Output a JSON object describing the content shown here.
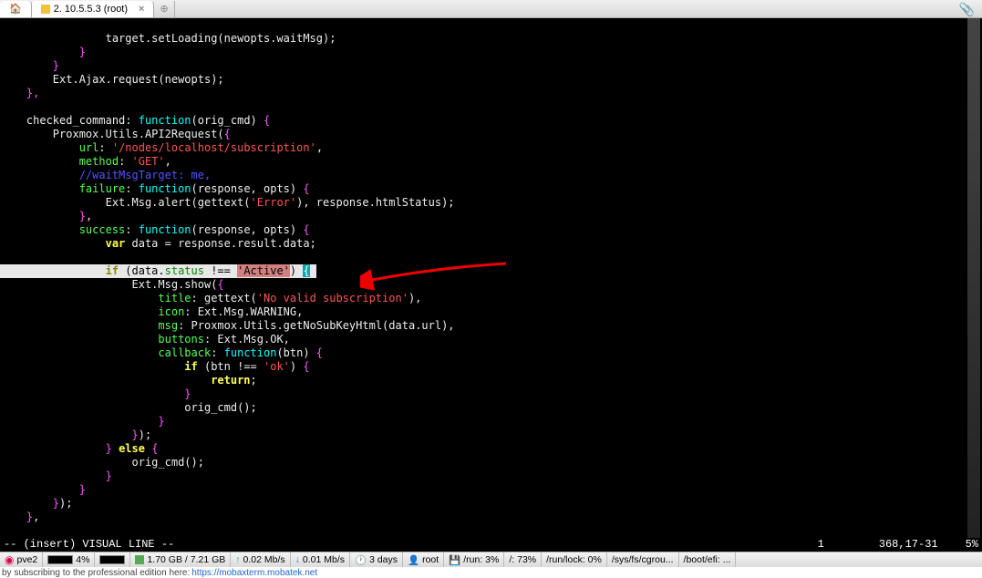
{
  "tabs": {
    "active_title": "2. 10.5.5.3 (root)"
  },
  "code": {
    "l1": "                target.setLoading(newopts.waitMsg);",
    "l2": "            }",
    "l3": "        }",
    "l4": "        Ext.Ajax.request(newopts);",
    "l5": "    },",
    "l6": "",
    "l7": "    checked_command: ",
    "l7b": "function",
    "l7c": "(orig_cmd) ",
    "l7d": "{",
    "l8": "        Proxmox.Utils.API2Request(",
    "l8b": "{",
    "l9": "            ",
    "l9a": "url",
    "l9b": ": ",
    "l9c": "'/nodes/localhost/subscription'",
    "l9d": ",",
    "l10a": "            ",
    "l10b": "method",
    "l10c": ": ",
    "l10d": "'GET'",
    "l10e": ",",
    "l11": "            //waitMsgTarget: me,",
    "l12a": "            ",
    "l12b": "failure",
    "l12c": ": ",
    "l12d": "function",
    "l12e": "(response, opts) ",
    "l12f": "{",
    "l13": "                Ext.Msg.alert(gettext(",
    "l13b": "'Error'",
    "l13c": "), response.htmlStatus);",
    "l14": "            ",
    "l14b": "}",
    "l14c": ",",
    "l15a": "            ",
    "l15b": "success",
    "l15c": ": ",
    "l15d": "function",
    "l15e": "(response, opts) ",
    "l15f": "{",
    "l16a": "                ",
    "l16b": "var",
    "l16c": " data = response.result.data;",
    "hl_pre": "                ",
    "hl_if": "if",
    "hl_open": " (data.",
    "hl_status": "status",
    "hl_neq": " !== ",
    "hl_active": "'Active'",
    "hl_close": ") ",
    "hl_brace": "{",
    "l18": "                    Ext.Msg.show(",
    "l18b": "{",
    "l19a": "                        ",
    "l19b": "title",
    "l19c": ": gettext(",
    "l19d": "'No valid subscription'",
    "l19e": "),",
    "l20a": "                        ",
    "l20b": "icon",
    "l20c": ": Ext.Msg.WARNING,",
    "l21a": "                        ",
    "l21b": "msg",
    "l21c": ": Proxmox.Utils.getNoSubKeyHtml(data.url),",
    "l22a": "                        ",
    "l22b": "buttons",
    "l22c": ": Ext.Msg.OK,",
    "l23a": "                        ",
    "l23b": "callback",
    "l23c": ": ",
    "l23d": "function",
    "l23e": "(btn) ",
    "l23f": "{",
    "l24a": "                            ",
    "l24b": "if",
    "l24c": " (btn !== ",
    "l24d": "'ok'",
    "l24e": ") ",
    "l24f": "{",
    "l25a": "                                ",
    "l25b": "return",
    "l25c": ";",
    "l26": "                            ",
    "l26b": "}",
    "l27": "                            orig_cmd();",
    "l28": "                        ",
    "l28b": "}",
    "l29": "                    ",
    "l29b": "}",
    "l29c": ");",
    "l30": "                ",
    "l30b": "}",
    "l30c": " ",
    "l30d": "else",
    "l30e": " ",
    "l30f": "{",
    "l31": "                    orig_cmd();",
    "l32": "                ",
    "l32b": "}",
    "l33": "            ",
    "l33b": "}",
    "l34": "        ",
    "l34b": "}",
    "l34c": ");",
    "l35": "    ",
    "l35b": "}",
    "l35c": ","
  },
  "status": {
    "mode": "-- (insert) VISUAL LINE --",
    "count": "1",
    "pos": "368,17-31",
    "pct": "5%"
  },
  "toolbar": {
    "host": "pve2",
    "cpu": "4%",
    "mem": "1.70 GB / 7.21 GB",
    "up": "0.02 Mb/s",
    "down": "0.01 Mb/s",
    "uptime": "3 days",
    "user": "root",
    "disk1": "/run: 3%",
    "disk2": "/: 73%",
    "disk3": "/run/lock: 0%",
    "disk4": "/sys/fs/cgrou...",
    "disk5": "/boot/efi: ..."
  },
  "footer": {
    "text": "by subscribing to the professional edition here:",
    "link": "https://mobaxterm.mobatek.net"
  }
}
